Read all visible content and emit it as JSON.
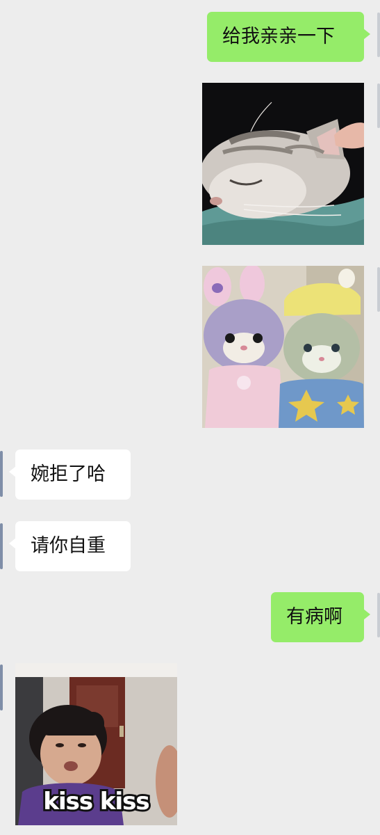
{
  "messages": [
    {
      "sender": "me",
      "type": "text",
      "text": "给我亲亲一下"
    },
    {
      "sender": "me",
      "type": "image",
      "icon": "sleeping-cat-photo"
    },
    {
      "sender": "me",
      "type": "image",
      "icon": "plush-toys-photo"
    },
    {
      "sender": "them",
      "type": "text",
      "text": "婉拒了哈"
    },
    {
      "sender": "them",
      "type": "text",
      "text": "请你自重"
    },
    {
      "sender": "me",
      "type": "text",
      "text": "有病啊"
    },
    {
      "sender": "them",
      "type": "image",
      "icon": "kiss-meme-photo",
      "caption": "kiss kiss"
    }
  ],
  "colors": {
    "background": "#ededed",
    "me_bubble": "#95ec69",
    "them_bubble": "#ffffff"
  }
}
